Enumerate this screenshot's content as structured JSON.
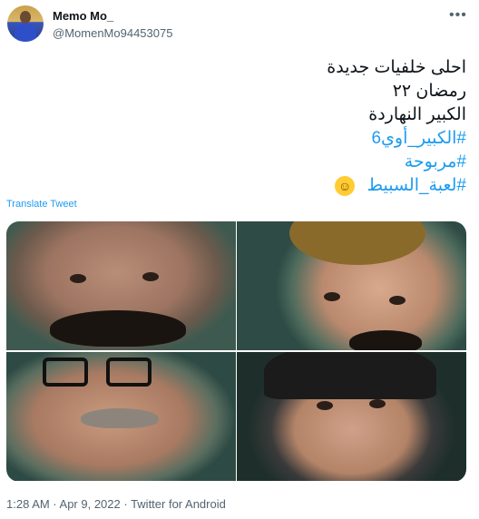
{
  "tweet": {
    "author_name": "Memo Mo_",
    "author_handle": "@MomenMo94453075",
    "more_icon": "more-horizontal-icon",
    "lines": [
      "احلى خلفيات جديدة",
      "رمضان ٢٢",
      "الكبير النهاردة"
    ],
    "hashtags": [
      "#الكبير_أوي6",
      "#مربوحة",
      "#لعبة_السبيط"
    ],
    "emoji": "😂",
    "translate_label": "Translate Tweet",
    "media_count": 4,
    "timestamp": "1:28 AM · Apr 9, 2022 · Twitter for Android"
  },
  "colors": {
    "link": "#1d9bf0",
    "secondary_text": "#536471",
    "primary_text": "#0f1419"
  }
}
